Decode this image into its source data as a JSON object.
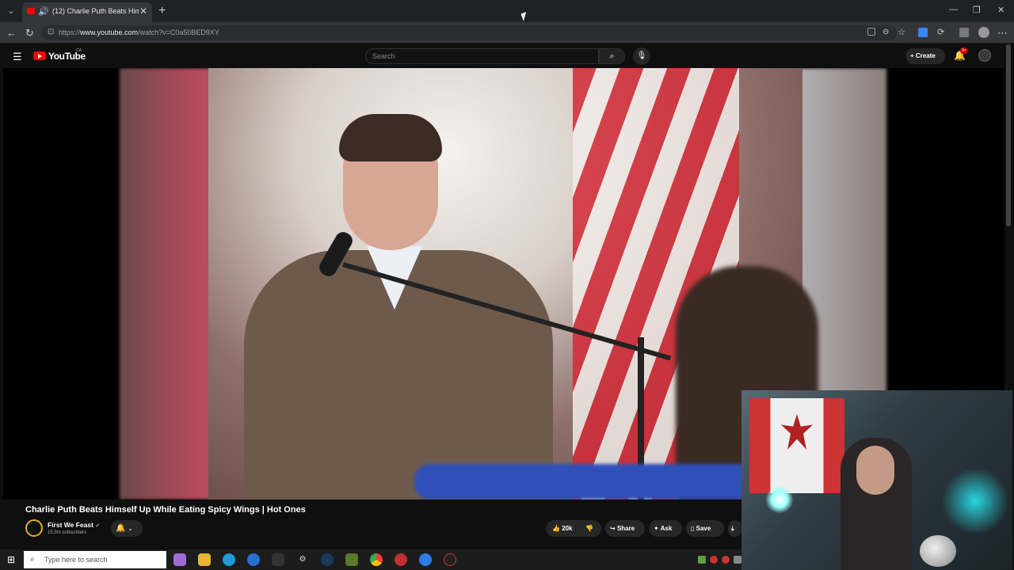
{
  "browser": {
    "tab_title": "(12) Charlie Puth Beats Himse",
    "tab_close": "✕",
    "new_tab": "+",
    "url_prefix": "https://",
    "url_domain": "www.youtube.com",
    "url_path": "/watch?v=C0a50BED9XY",
    "window_minimize": "—",
    "window_restore": "❐",
    "window_close": "✕"
  },
  "youtube": {
    "logo_text": "YouTube",
    "region": "CA",
    "search_placeholder": "Search",
    "create_label": "Create",
    "notification_badge": "9+"
  },
  "video": {
    "title": "Charlie Puth Beats Himself Up While Eating Spicy Wings | Hot Ones",
    "channel_name": "First We Feast",
    "channel_verified": "✔",
    "subscribers": "15.3m subscribers",
    "likes": "20k",
    "share_label": "Share",
    "ask_label": "Ask",
    "save_label": "Save"
  },
  "taskbar": {
    "search_placeholder": "Type here to search"
  },
  "colors": {
    "youtube_red": "#ff0000",
    "background": "#0f0f0f",
    "pill_bg": "#272727"
  }
}
